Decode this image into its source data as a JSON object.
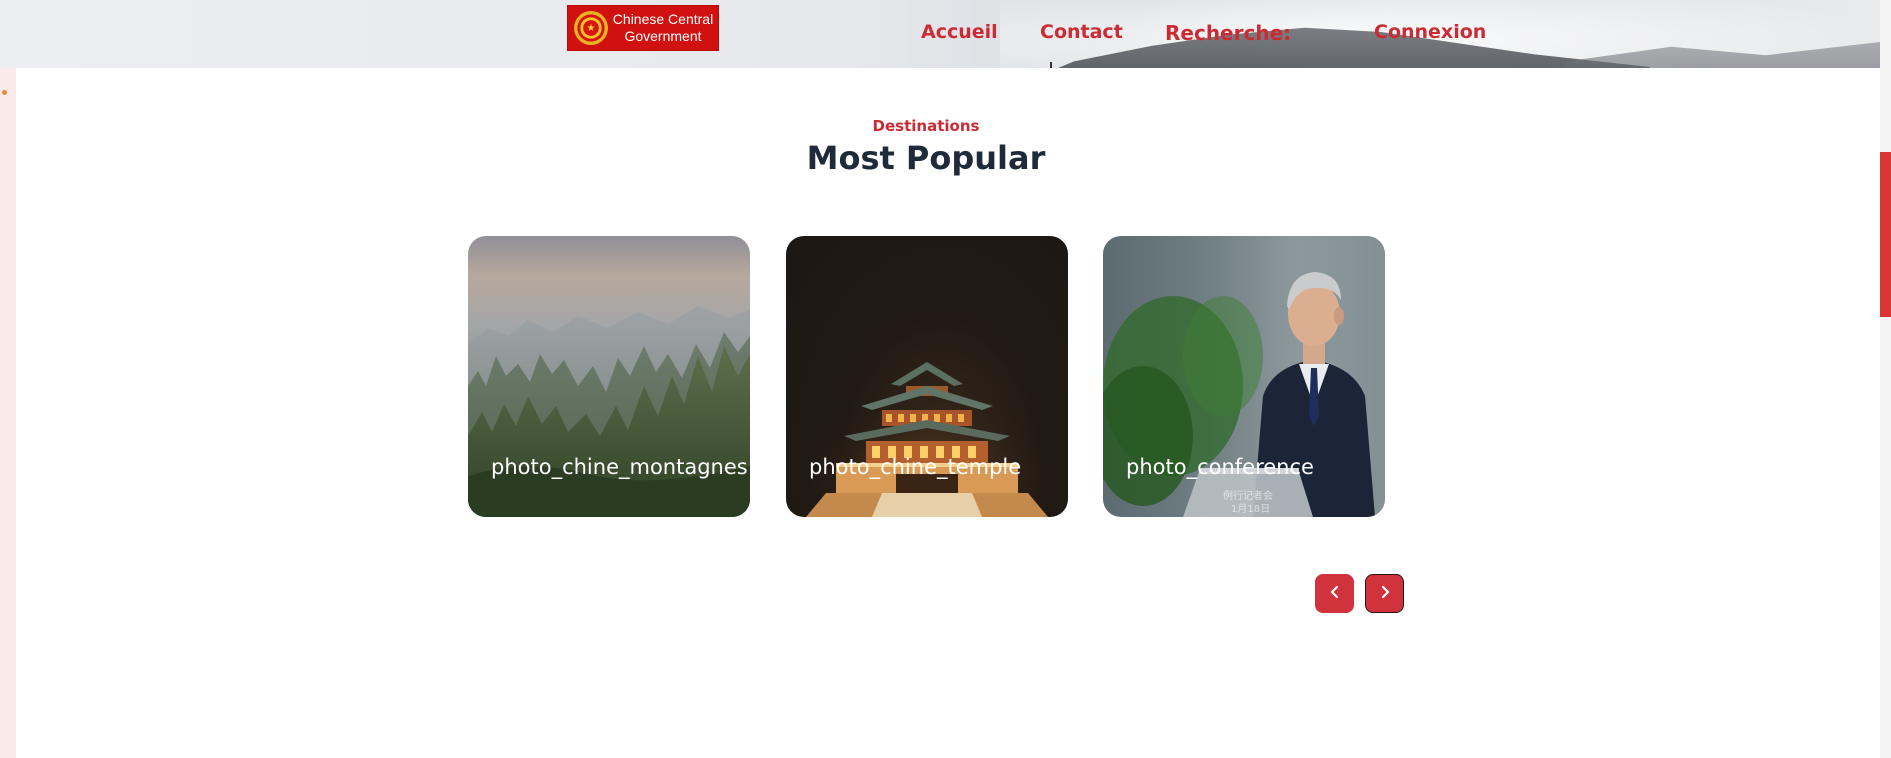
{
  "header": {
    "logo_text": "Chinese Central Government",
    "nav": {
      "accueil": "Accueil",
      "contact": "Contact",
      "recherche": "Recherche:",
      "connexion": "Connexion"
    }
  },
  "section": {
    "eyebrow": "Destinations",
    "title": "Most Popular"
  },
  "cards": [
    {
      "caption": "photo_chine_montagnes"
    },
    {
      "caption": "photo_chine_temple"
    },
    {
      "caption": "photo_conference"
    }
  ],
  "conference_overlay": {
    "line1": "例行记者会",
    "line2": "1月18日"
  },
  "carousel": {
    "prev_icon": "chevron-left-icon",
    "next_icon": "chevron-right-icon"
  },
  "colors": {
    "accent": "#cc2b33",
    "button": "#d0333b",
    "title": "#1f2b3a",
    "logo_bg": "#d0110f",
    "scrollbar": "#d93535"
  }
}
